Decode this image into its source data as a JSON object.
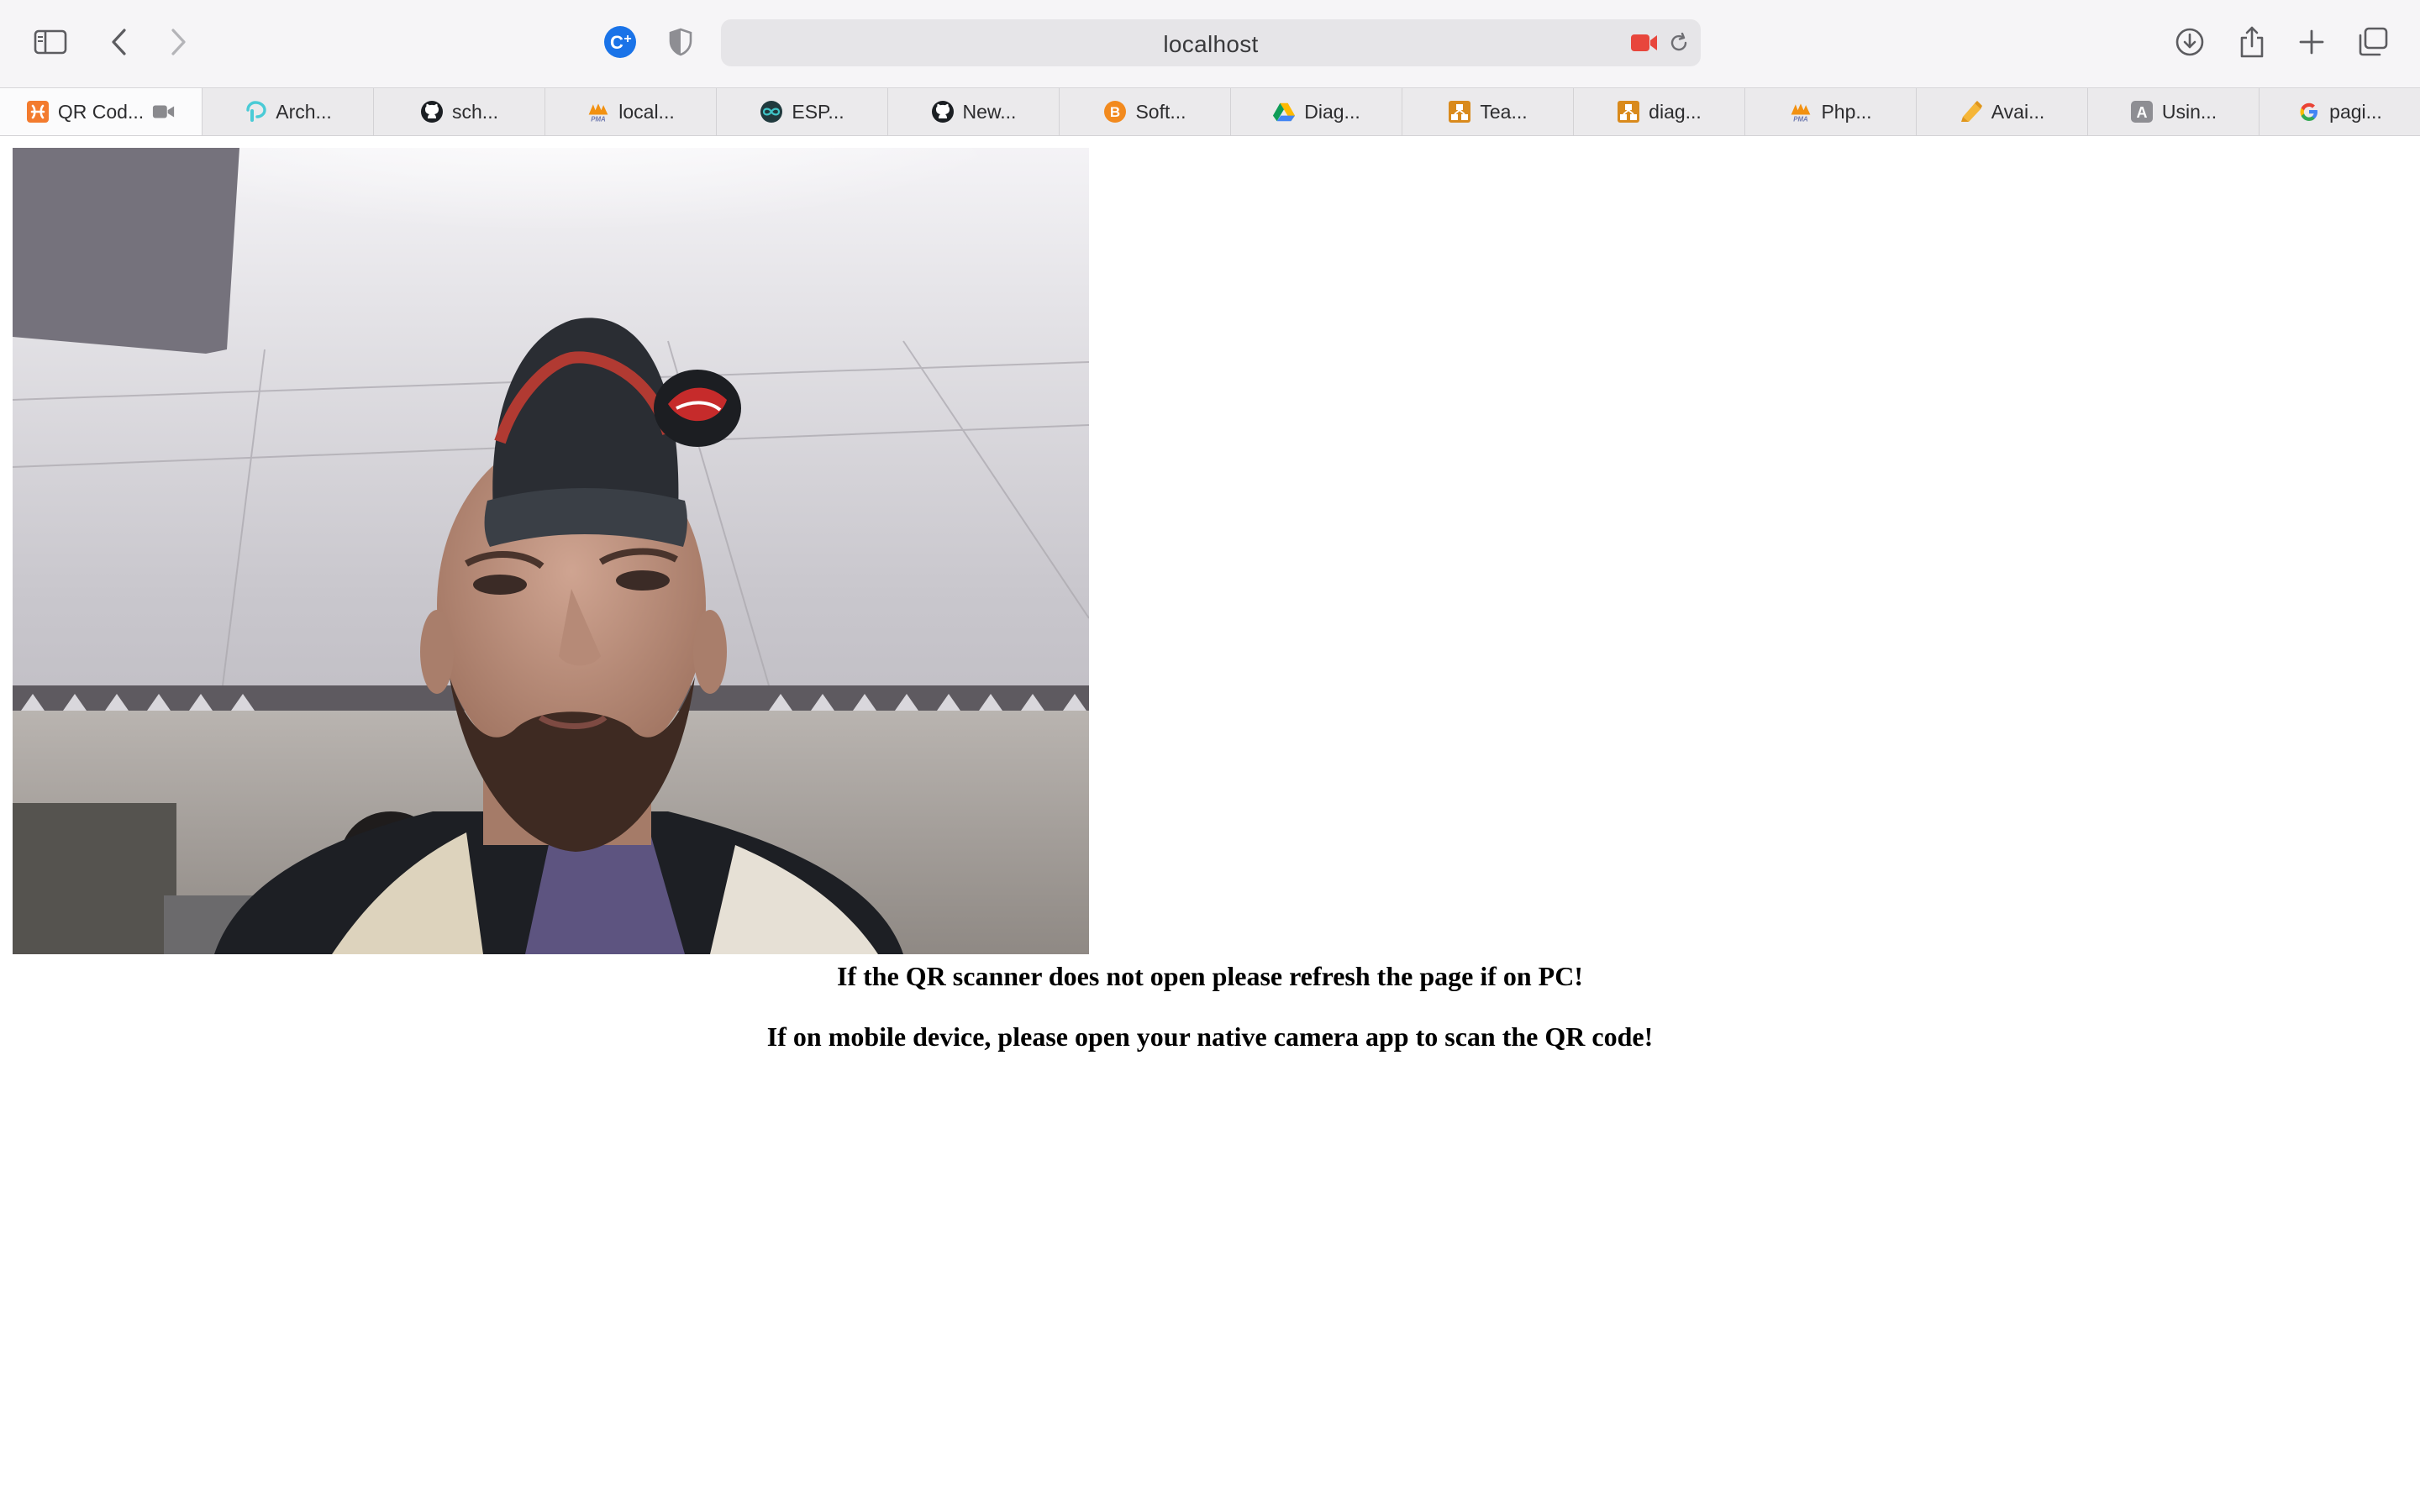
{
  "browser": {
    "url": "localhost",
    "toolbar_icons": [
      "sidebar-icon",
      "back-icon",
      "forward-icon",
      "extension-icon",
      "privacy-shield-icon",
      "camera-recording-icon",
      "reload-icon",
      "download-icon",
      "share-icon",
      "new-tab-icon",
      "tab-overview-icon"
    ],
    "accent_colors": {
      "extension": "#1a73e8",
      "camera_recording": "#e8463c"
    }
  },
  "tabs": [
    {
      "label": "QR Cod...",
      "icon": "xampp-icon",
      "active": true,
      "status_icon": "video-camera-icon"
    },
    {
      "label": "Arch...",
      "icon": "tplink-icon"
    },
    {
      "label": "sch...",
      "icon": "github-icon"
    },
    {
      "label": "local...",
      "icon": "phpmyadmin-icon"
    },
    {
      "label": "ESP...",
      "icon": "arduino-icon"
    },
    {
      "label": "New...",
      "icon": "github-icon"
    },
    {
      "label": "Soft...",
      "icon": "orange-b-icon"
    },
    {
      "label": "Diag...",
      "icon": "google-drive-icon"
    },
    {
      "label": "Tea...",
      "icon": "diagram-icon"
    },
    {
      "label": "diag...",
      "icon": "diagram-icon"
    },
    {
      "label": "Php...",
      "icon": "phpmyadmin-icon"
    },
    {
      "label": "Avai...",
      "icon": "pencil-icon"
    },
    {
      "label": "Usin...",
      "icon": "letter-a-icon"
    },
    {
      "label": "pagi...",
      "icon": "google-icon"
    }
  ],
  "page": {
    "camera_feed": "webcam-video",
    "message_pc": "If the QR scanner does not open please refresh the page if on PC!",
    "message_mobile": "If on mobile device, please open your native camera app to scan the QR code!"
  }
}
